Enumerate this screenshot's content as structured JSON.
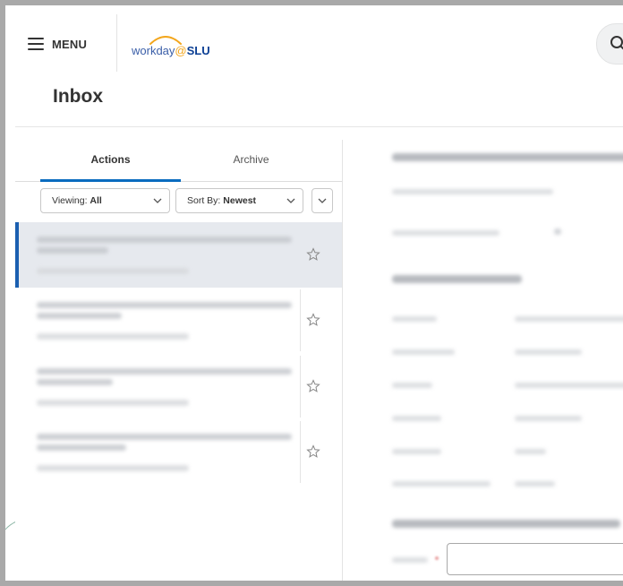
{
  "header": {
    "menu_label": "MENU",
    "logo": {
      "word": "workday",
      "at": "@",
      "org": "SLU"
    },
    "search_icon": "search-icon"
  },
  "page": {
    "title": "Inbox"
  },
  "tabs": [
    {
      "label": "Actions",
      "active": true
    },
    {
      "label": "Archive",
      "active": false
    }
  ],
  "filters": {
    "viewing_prefix": "Viewing: ",
    "viewing_value": "All",
    "sort_prefix": "Sort By: ",
    "sort_value": "Newest"
  },
  "inbox_items": [
    {
      "selected": true,
      "starred": false
    },
    {
      "selected": false,
      "starred": false
    },
    {
      "selected": false,
      "starred": false
    },
    {
      "selected": false,
      "starred": false
    }
  ],
  "colors": {
    "accent_tab": "#0a6cbf",
    "selected_bar": "#1a5fb0",
    "logo_orange": "#f3a61c",
    "logo_blue": "#0b3f94"
  }
}
